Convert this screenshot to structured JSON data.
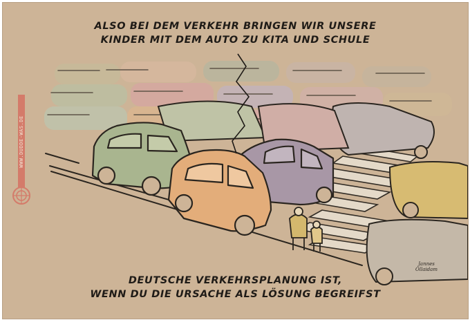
{
  "captions": {
    "top_line1": "ALSO BEI DEM VERKEHR BRINGEN WIR UNSERE",
    "top_line2": "KINDER MIT DEM AUTO ZU KITA UND SCHULE",
    "bottom_line1": "DEUTSCHE VERKEHRSPLANUNG IST,",
    "bottom_line2": "WENN DU DIE URSACHE ALS LÖSUNG BEGREIFST"
  },
  "side_url": "WWW.DUDDE-WAS.DE",
  "signature": "Jannes Ollaidam",
  "colors": {
    "paper": "#cdb497",
    "ink": "#1f1b17",
    "car_green": "#a9b58f",
    "car_orange": "#e3ad7a",
    "car_purple": "#a897a6",
    "car_yellow": "#d7bb72",
    "stamp_red": "#d47b6a"
  }
}
